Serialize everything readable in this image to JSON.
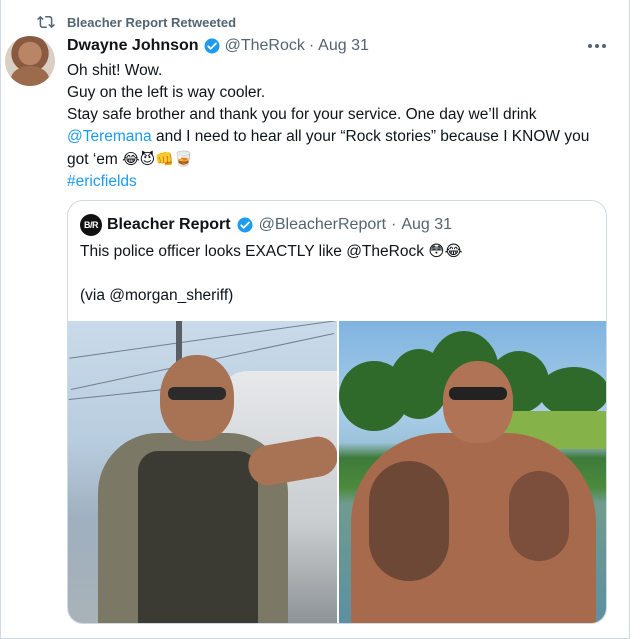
{
  "retweet": {
    "label": "Bleacher Report Retweeted",
    "icon": "retweet-icon"
  },
  "tweet": {
    "author_name": "Dwayne Johnson",
    "handle": "@TheRock",
    "separator": "·",
    "date": "Aug 31",
    "verified_icon": "verified-badge-icon",
    "line1": "Oh shit! Wow.",
    "line2": "Guy on the left is way cooler.",
    "line3": "Stay safe brother and thank you for your service. One day we’ll drink",
    "mention": "@Teremana",
    "line4_rest": " and I need to hear all your “Rock stories” because I KNOW you",
    "line5": "got ‘em ",
    "emojis": "😂😈👊🥃",
    "hashtag": "#ericfields"
  },
  "quote": {
    "logo_text": "B/R",
    "author_name": "Bleacher Report",
    "handle": "@BleacherReport",
    "separator": "·",
    "date": "Aug 31",
    "line1": "This police officer looks EXACTLY like @TheRock 😳😂",
    "line2": "(via @morgan_sheriff)"
  },
  "colors": {
    "link": "#1d9bf0",
    "secondary_text": "#536471",
    "primary_text": "#0f1419",
    "border": "#cfd9de"
  }
}
